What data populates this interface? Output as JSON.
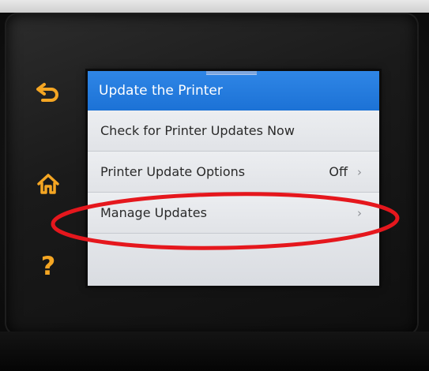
{
  "screen": {
    "title": "Update the Printer",
    "menu_items": [
      {
        "label": "Check for Printer Updates Now"
      },
      {
        "label": "Printer Update Options",
        "value": "Off",
        "chevron": "›"
      },
      {
        "label": "Manage Updates",
        "chevron": "›"
      }
    ]
  },
  "side_buttons": {
    "back_icon": "back-arrow-icon",
    "home_icon": "home-icon",
    "help_label": "?"
  },
  "colors": {
    "side_button_accent": "#f5a623",
    "title_bar": "#1f78dc",
    "highlight_annotation": "#e5171d"
  }
}
